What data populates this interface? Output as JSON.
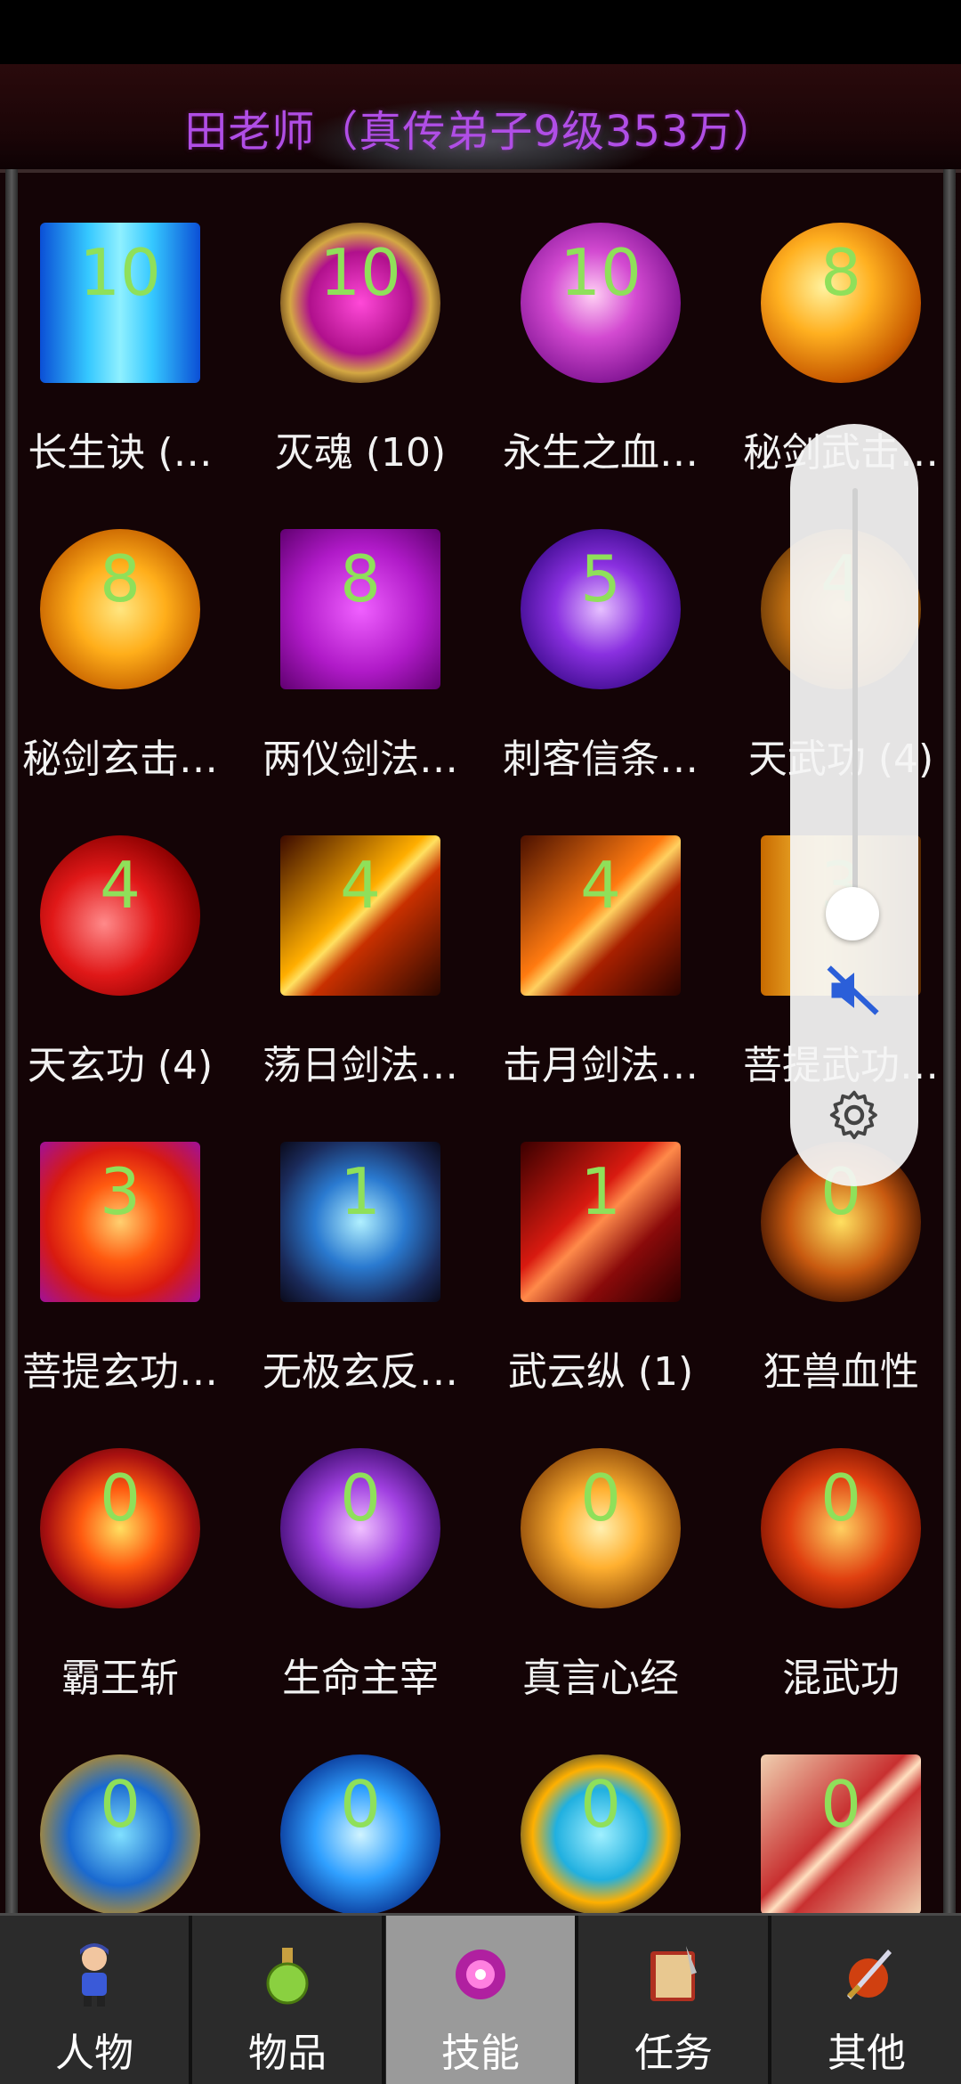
{
  "title": "田老师（真传弟子9级353万）",
  "skills": [
    {
      "level": "10",
      "name": "长生诀 (…"
    },
    {
      "level": "10",
      "name": "灭魂 (10)"
    },
    {
      "level": "10",
      "name": "永生之血…"
    },
    {
      "level": "8",
      "name": "秘剑武击…"
    },
    {
      "level": "8",
      "name": "秘剑玄击…"
    },
    {
      "level": "8",
      "name": "两仪剑法…"
    },
    {
      "level": "5",
      "name": "刺客信条…"
    },
    {
      "level": "4",
      "name": "天武功 (4)"
    },
    {
      "level": "4",
      "name": "天玄功 (4)"
    },
    {
      "level": "4",
      "name": "荡日剑法…"
    },
    {
      "level": "4",
      "name": "击月剑法…"
    },
    {
      "level": "3",
      "name": "菩提武功…"
    },
    {
      "level": "3",
      "name": "菩提玄功…"
    },
    {
      "level": "1",
      "name": "无极玄反…"
    },
    {
      "level": "1",
      "name": "武云纵 (1)"
    },
    {
      "level": "0",
      "name": "狂兽血性"
    },
    {
      "level": "0",
      "name": "霸王斩"
    },
    {
      "level": "0",
      "name": "生命主宰"
    },
    {
      "level": "0",
      "name": "真言心经"
    },
    {
      "level": "0",
      "name": "混武功"
    },
    {
      "level": "0",
      "name": ""
    },
    {
      "level": "0",
      "name": ""
    },
    {
      "level": "0",
      "name": ""
    },
    {
      "level": "0",
      "name": ""
    }
  ],
  "tabs": [
    {
      "label": "人物",
      "icon": "character-icon"
    },
    {
      "label": "物品",
      "icon": "potion-icon"
    },
    {
      "label": "技能",
      "icon": "skill-orb-icon"
    },
    {
      "label": "任务",
      "icon": "quest-book-icon"
    },
    {
      "label": "其他",
      "icon": "sword-icon"
    }
  ],
  "active_tab": "技能",
  "volume": {
    "level_fraction": 0.2,
    "muted": true
  },
  "colors": {
    "title": "#b04ee6",
    "level": "#8fe05a",
    "active_tab": "#9a9a9a"
  }
}
